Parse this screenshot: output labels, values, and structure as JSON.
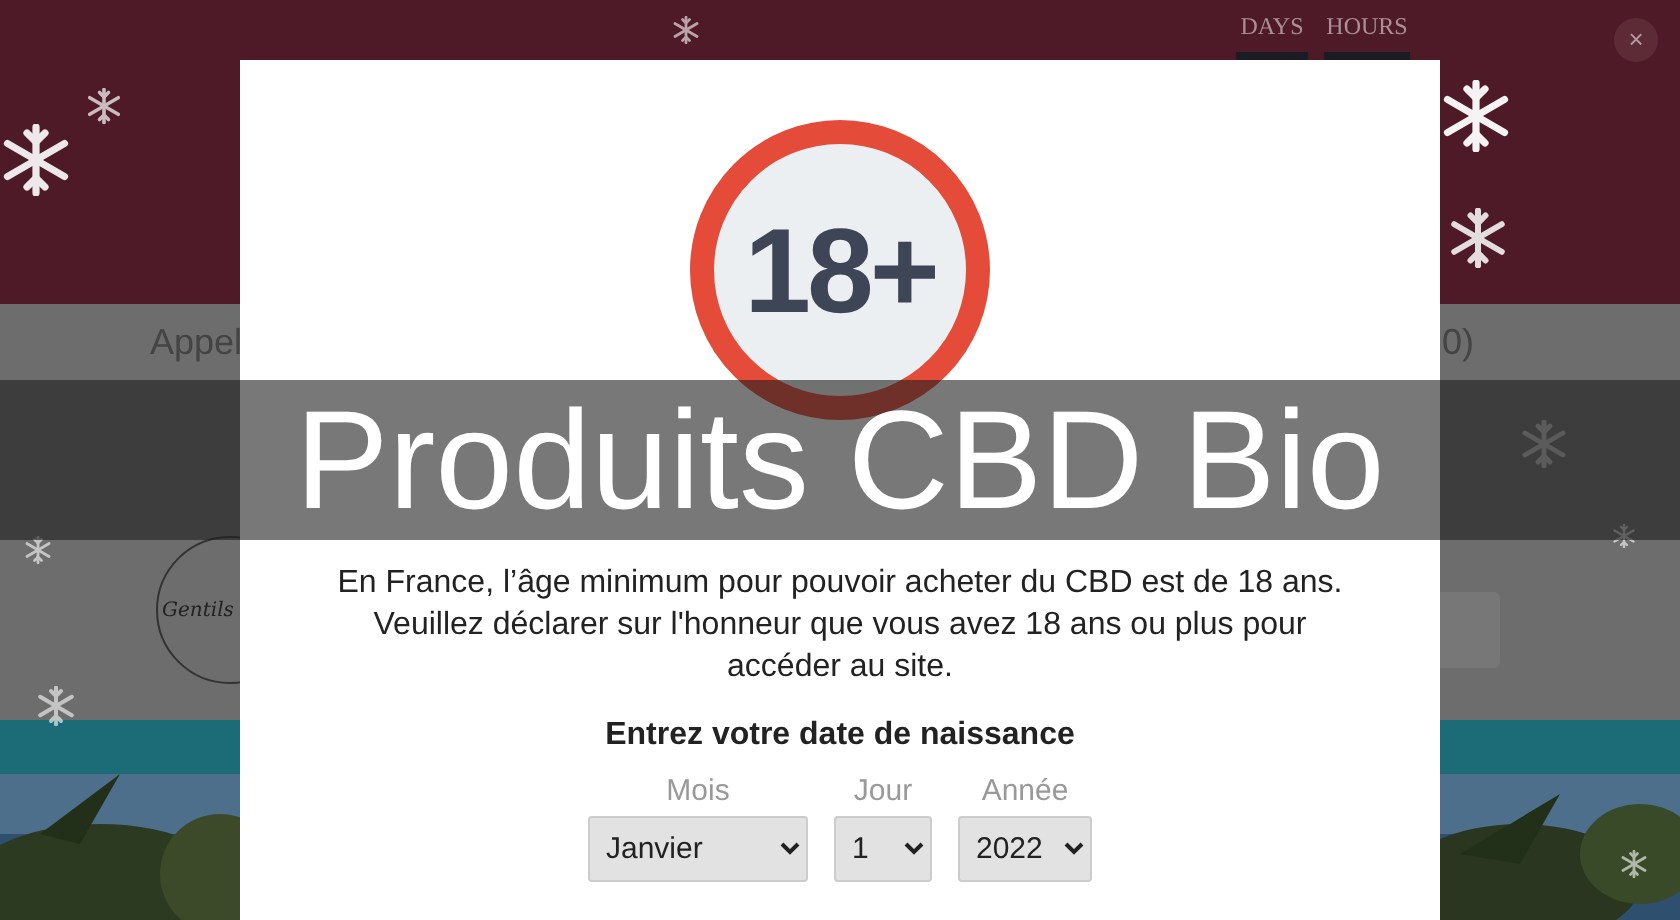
{
  "header": {
    "countdown": [
      {
        "label": "DAYS"
      },
      {
        "label": "HOURS"
      }
    ],
    "close": "×"
  },
  "nav": {
    "left_fragment": "Appel",
    "right_fragment": "0)"
  },
  "logo": {
    "text": "Gentils"
  },
  "modal": {
    "badge": "18+",
    "message": "En France, l’âge minimum pour pouvoir acheter du CBD est de 18 ans. Veuillez déclarer sur l'honneur que vous avez 18 ans ou plus pour accéder au site.",
    "prompt": "Entrez votre date de naissance",
    "fields": [
      {
        "label": "Mois",
        "value": "Janvier"
      },
      {
        "label": "Jour",
        "value": "1"
      },
      {
        "label": "Année",
        "value": "2022"
      }
    ]
  },
  "caption": "Produits CBD Bio"
}
